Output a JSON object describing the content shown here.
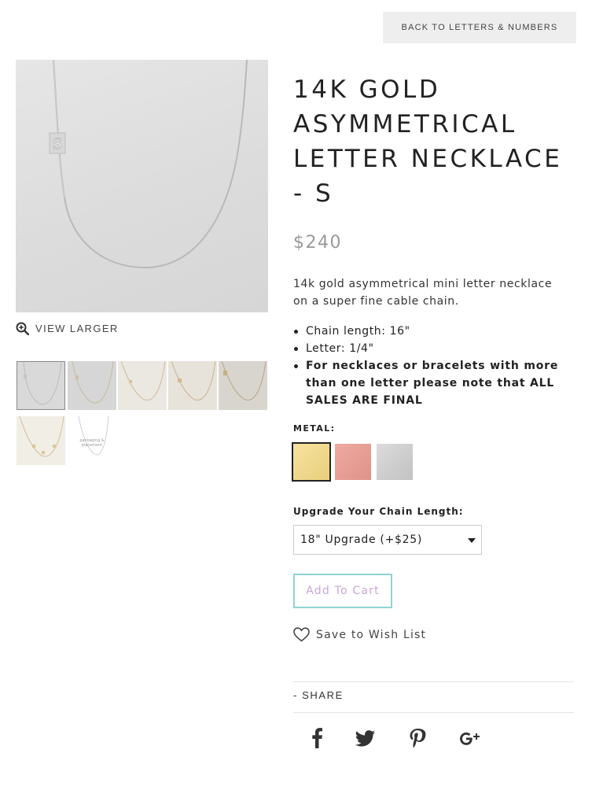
{
  "nav": {
    "back_label": "BACK TO LETTERS & NUMBERS"
  },
  "gallery": {
    "main_letter": "S",
    "view_larger_label": "VIEW LARGER",
    "packaging_text": "packaging & placement"
  },
  "product": {
    "title": "14K GOLD ASYMMETRICAL LETTER NECKLACE - S",
    "price": "$240",
    "description": "14k gold asymmetrical mini letter necklace on a super fine cable chain.",
    "bullets": [
      "Chain length: 16\"",
      "Letter: 1/4\"",
      "For necklaces or bracelets with more than one letter please note that ALL SALES ARE FINAL"
    ]
  },
  "metal": {
    "label": "METAL:",
    "options": [
      {
        "name": "gold",
        "color": "#f0d98a",
        "selected": true
      },
      {
        "name": "rose-gold",
        "color": "#e59d94",
        "selected": false
      },
      {
        "name": "silver",
        "color": "#cfcfcf",
        "selected": false
      }
    ]
  },
  "chain": {
    "label": "Upgrade Your Chain Length:",
    "selected": "18\" Upgrade (+$25)"
  },
  "cart": {
    "add_label": "Add To Cart"
  },
  "wishlist": {
    "label": "Save to Wish List"
  },
  "share": {
    "label": "-  SHARE",
    "networks": [
      "facebook",
      "twitter",
      "pinterest",
      "google-plus"
    ]
  },
  "colors": {
    "accent_border": "#8fd4d1",
    "cart_text": "#c9a7d8",
    "price": "#999999"
  }
}
